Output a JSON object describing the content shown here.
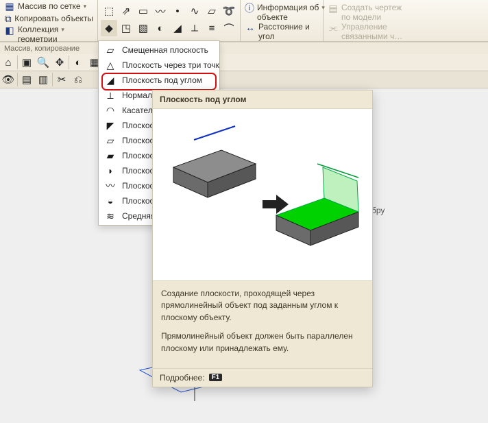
{
  "ribbon": {
    "group1": {
      "btn_grid": "Массив по сетке",
      "btn_copy": "Копировать объекты",
      "btn_collection_l1": "Коллекция",
      "btn_collection_l2": "геометрии",
      "panel_label": "Массив, копирование"
    },
    "info_group": {
      "info_l1": "Информация об",
      "info_l2": "объекте",
      "dist_l1": "Расстояние и",
      "dist_l2": "угол"
    },
    "disabled_group": {
      "a_l1": "Создать чертеж",
      "a_l2": "по модели",
      "b_l1": "Управление",
      "b_l2": "связанными ч…"
    }
  },
  "menu": {
    "items": [
      "Смещенная плоскость",
      "Плоскость через три точки",
      "Плоскость под углом",
      "Нормальная плоскость",
      "Касательная плоскость",
      "Плоскость через ребро и вершину",
      "Плоскость через вершину параллельно",
      "Плоскость через вершину перпендикулярно",
      "Плоскость касательная к грани",
      "Плоскость через плоскую кривую",
      "Плоскость, касательная к грани в точке",
      "Средняя плоскость"
    ],
    "highlight_index": 2
  },
  "leaked_text": "бру",
  "tooltip": {
    "title": "Плоскость под углом",
    "desc1": "Создание плоскости, проходящей через прямолинейный объект под заданным углом к плоскому объекту.",
    "desc2": "Прямолинейный объект должен быть параллелен плоскому или принадлежать ему.",
    "more": "Подробнее:",
    "more_key": "F1"
  }
}
